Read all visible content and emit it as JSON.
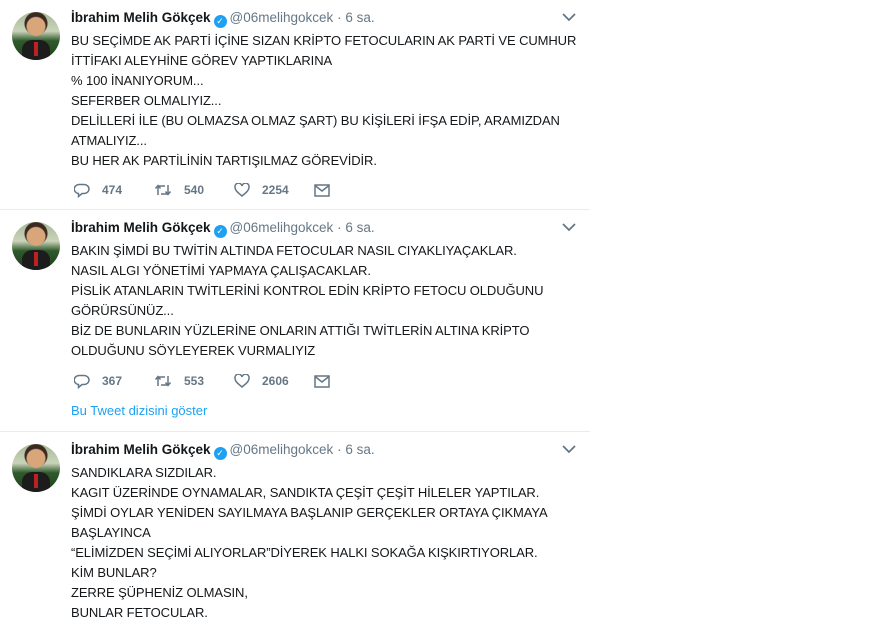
{
  "tweets": [
    {
      "name": "İbrahim Melih Gökçek",
      "handle": "@06melihgokcek",
      "time": "6 sa.",
      "lines": [
        "BU SEÇİMDE AK PARTİ İÇİNE SIZAN KRİPTO FETOCULARIN AK PARTİ VE CUMHUR",
        "İTTİFAKI ALEYHİNE GÖREV YAPTIKLARINA",
        "% 100 İNANIYORUM...",
        "SEFERBER OLMALIYIZ...",
        "DELİLLERİ İLE (BU OLMAZSA OLMAZ ŞART) BU KİŞİLERİ İFŞA EDİP, ARAMIZDAN",
        "ATMALIYIZ...",
        "BU HER AK PARTİLİNİN TARTIŞILMAZ GÖREVİDİR."
      ],
      "replies": "474",
      "retweets": "540",
      "likes": "2254"
    },
    {
      "name": "İbrahim Melih Gökçek",
      "handle": "@06melihgokcek",
      "time": "6 sa.",
      "lines": [
        "BAKIN ŞİMDİ BU TWİTİN ALTINDA FETOCULAR NASIL CIYAKLIYAÇAKLAR.",
        "NASIL ALGI YÖNETİMİ YAPMAYA ÇALIŞACAKLAR.",
        "PİSLİK ATANLARIN TWİTLERİNİ KONTROL EDİN KRİPTO FETOCU OLDUĞUNU",
        "GÖRÜRSÜNÜZ...",
        "BİZ DE BUNLARIN YÜZLERİNE ONLARIN ATTIĞI TWİTLERİN ALTINA KRİPTO",
        "OLDUĞUNU SÖYLEYEREK VURMALIYIZ"
      ],
      "replies": "367",
      "retweets": "553",
      "likes": "2606",
      "thread_link": "Bu Tweet dizisini göster"
    },
    {
      "name": "İbrahim Melih Gökçek",
      "handle": "@06melihgokcek",
      "time": "6 sa.",
      "lines": [
        "SANDIKLARA SIZDILAR.",
        "KAGIT ÜZERİNDE OYNAMALAR, SANDIKTA ÇEŞİT ÇEŞİT HİLELER YAPTILAR.",
        "ŞİMDİ OYLAR YENİDEN SAYILMAYA BAŞLANIP GERÇEKLER ORTAYA ÇIKMAYA",
        "BAŞLAYINCA",
        "“ELİMİZDEN SEÇİMİ ALIYORLAR”DİYEREK HALKI SOKAĞA KIŞKIRTIYORLAR.",
        "KİM BUNLAR?",
        "ZERRE ŞÜPHENİZ OLMASIN,",
        "BUNLAR FETOCULAR."
      ]
    }
  ],
  "icons": {
    "verified": "verified-badge-icon",
    "reply": "reply-icon",
    "retweet": "retweet-icon",
    "like": "heart-icon",
    "dm": "envelope-icon",
    "more": "chevron-down-icon"
  },
  "colors": {
    "link": "#1da1f2",
    "muted": "#657786",
    "text": "#14171a"
  }
}
